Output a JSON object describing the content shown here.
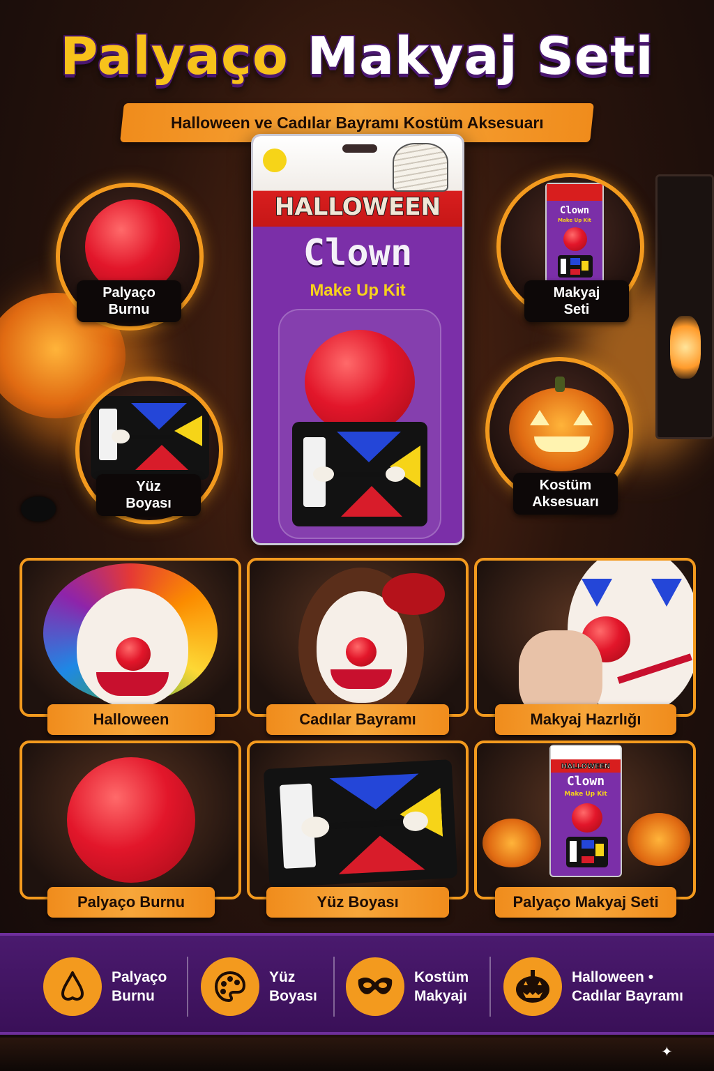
{
  "title": {
    "part1": "Palyaço",
    "part2": "Makyaj Seti"
  },
  "subtitle": "Halloween ve Cadılar Bayramı Kostüm Aksesuarı",
  "package": {
    "brand": "HALLOWEEN",
    "product": "Clown",
    "kit": "Make Up Kit"
  },
  "circles": {
    "top_left": {
      "line1": "Palyaço",
      "line2": "Burnu"
    },
    "bottom_left": {
      "line1": "Yüz",
      "line2": "Boyası"
    },
    "top_right": {
      "line1": "Makyaj",
      "line2": "Seti",
      "mini_product": "Clown",
      "mini_kit": "Make Up Kit"
    },
    "bottom_right": {
      "line1": "Kostüm",
      "line2": "Aksesuarı"
    }
  },
  "cards": [
    {
      "label": "Halloween"
    },
    {
      "label": "Cadılar Bayramı"
    },
    {
      "label": "Makyaj Hazrlığı"
    },
    {
      "label": "Palyaço Burnu"
    },
    {
      "label": "Yüz Boyası"
    },
    {
      "label": "Palyaço Makyaj Seti",
      "mini_brand": "HALLOWEEN",
      "mini_product": "Clown",
      "mini_kit": "Make Up Kit"
    }
  ],
  "features": [
    {
      "icon": "nose-icon",
      "line1": "Palyaço",
      "line2": "Burnu"
    },
    {
      "icon": "palette-icon",
      "line1": "Yüz",
      "line2": "Boyası"
    },
    {
      "icon": "mask-icon",
      "line1": "Kostüm",
      "line2": "Makyajı"
    },
    {
      "icon": "pumpkin-icon",
      "line1": "Halloween •",
      "line2": "Cadılar Bayramı"
    }
  ],
  "colors": {
    "accent_orange": "#f39a1e",
    "title_yellow": "#f7c21b",
    "purple": "#4a1a6e",
    "nose_red": "#e2162a"
  }
}
